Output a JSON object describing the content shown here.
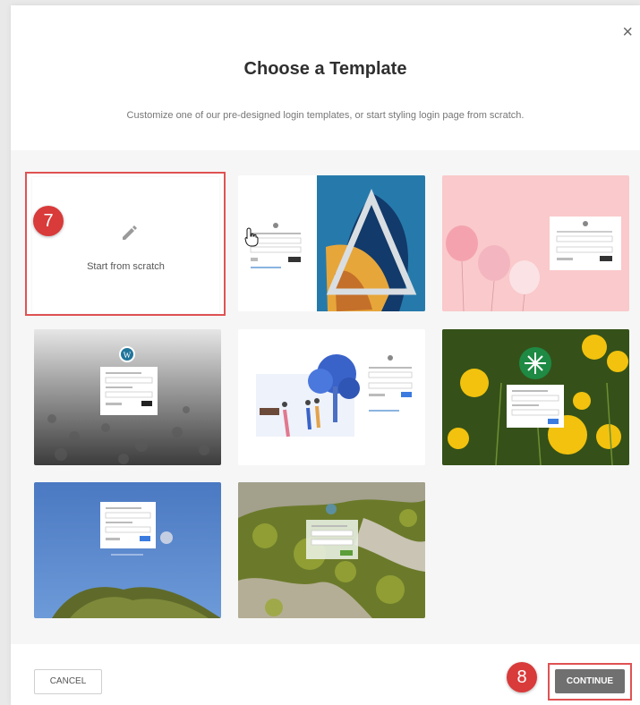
{
  "dialog": {
    "close_glyph": "×",
    "title": "Choose a Template",
    "subtitle": "Customize one of our pre-designed login templates, or start styling login page from scratch."
  },
  "templates": [
    {
      "label": "Start from scratch",
      "kind": "scratch",
      "selected": true
    },
    {
      "kind": "split-illustration"
    },
    {
      "kind": "balloons-pink"
    },
    {
      "kind": "wordpress-gravel"
    },
    {
      "kind": "park-illustration"
    },
    {
      "kind": "dandelion"
    },
    {
      "kind": "blue-sky"
    },
    {
      "kind": "moss-bark"
    }
  ],
  "annotations": {
    "step_template": "7",
    "step_continue": "8",
    "accent": "#e05253"
  },
  "footer": {
    "cancel_label": "CANCEL",
    "continue_label": "CONTINUE"
  },
  "icons": [
    "close-icon",
    "pencil-icon",
    "hand-cursor-icon",
    "wordpress-icon",
    "snowflake-logo-icon"
  ]
}
